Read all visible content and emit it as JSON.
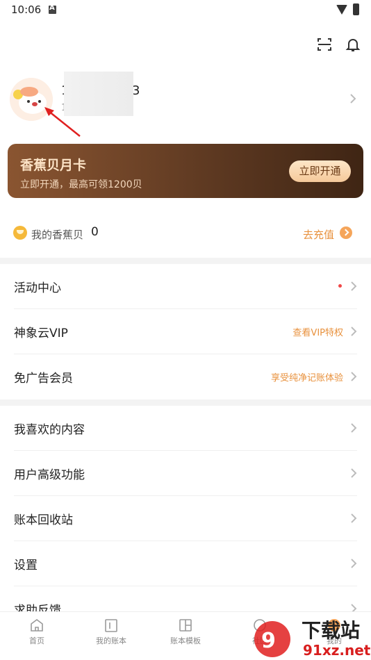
{
  "status_bar": {
    "time": "10:06"
  },
  "profile": {
    "name_start": "1",
    "name_end": "3",
    "sub": "1"
  },
  "vip_card": {
    "title": "香蕉贝月卡",
    "subtitle": "立即开通，最高可领1200贝",
    "button": "立即开通"
  },
  "balance": {
    "label": "我的香蕉贝",
    "value": "0",
    "recharge": "去充值"
  },
  "menu_group_1": [
    {
      "label": "活动中心",
      "hint": ""
    },
    {
      "label": "神象云VIP",
      "hint": "查看VIP特权"
    },
    {
      "label": "免广告会员",
      "hint": "享受纯净记账体验"
    }
  ],
  "menu_group_2": [
    {
      "label": "我喜欢的内容"
    },
    {
      "label": "用户高级功能"
    },
    {
      "label": "账本回收站"
    },
    {
      "label": "设置"
    },
    {
      "label": "求助反馈"
    }
  ],
  "bottom_nav": [
    {
      "label": "首页"
    },
    {
      "label": "我的账本"
    },
    {
      "label": "账本模板"
    },
    {
      "label": "社区"
    },
    {
      "label": "我的"
    }
  ],
  "watermark": {
    "brand": "下载站",
    "domain": "91xz.net"
  },
  "colors": {
    "accent": "#e8913d",
    "card_dark": "#5f3a22",
    "card_text": "#fbe2c5",
    "dot": "#f04848"
  }
}
